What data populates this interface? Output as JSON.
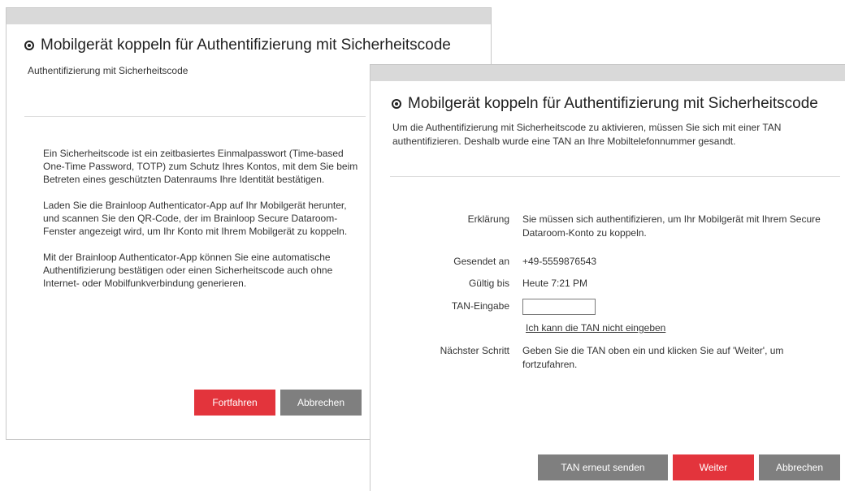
{
  "dialog_back": {
    "title": "Mobilgerät koppeln für Authentifizierung mit Sicherheitscode",
    "subtitle": "Authentifizierung mit Sicherheitscode",
    "paragraphs": [
      "Ein Sicherheitscode ist ein zeitbasiertes Einmalpasswort (Time-based One-Time Password, TOTP) zum Schutz Ihres Kontos, mit dem Sie beim Betreten eines geschützten Datenraums Ihre Identität bestätigen.",
      "Laden Sie die Brainloop Authenticator-App auf Ihr Mobilgerät herunter, und scannen Sie den QR-Code, der im Brainloop Secure Dataroom-Fenster angezeigt wird, um Ihr Konto mit Ihrem Mobilgerät zu koppeln.",
      "Mit der Brainloop Authenticator-App können Sie eine automatische Authentifizierung bestätigen oder einen Sicherheitscode auch ohne Internet- oder Mobilfunkverbindung generieren."
    ],
    "buttons": {
      "continue": "Fortfahren",
      "cancel": "Abbrechen"
    }
  },
  "dialog_front": {
    "title": "Mobilgerät koppeln für Authentifizierung mit Sicherheitscode",
    "intro": "Um die Authentifizierung mit Sicherheitscode zu aktivieren, müssen Sie sich mit einer TAN authentifizieren. Deshalb wurde eine TAN an Ihre Mobiltelefonnummer gesandt.",
    "fields": {
      "explanation_label": "Erklärung",
      "explanation_value": "Sie müssen sich authentifizieren, um Ihr Mobilgerät mit Ihrem Secure Dataroom-Konto zu koppeln.",
      "sent_to_label": "Gesendet an",
      "sent_to_value": "+49-5559876543",
      "valid_until_label": "Gültig bis",
      "valid_until_value": "Heute 7:21 PM",
      "tan_label": "TAN-Eingabe",
      "tan_value": "",
      "cannot_enter_link": "Ich kann die TAN nicht eingeben",
      "next_step_label": "Nächster Schritt",
      "next_step_value": "Geben Sie die TAN oben ein und klicken Sie auf 'Weiter', um fortzufahren."
    },
    "buttons": {
      "resend": "TAN erneut senden",
      "next": "Weiter",
      "cancel": "Abbrechen"
    }
  },
  "colors": {
    "accent_red": "#e3343c",
    "button_grey": "#7f7f7f",
    "header_bar": "#d9d9d9"
  },
  "icons": {
    "title_icon": "radio-target-icon"
  }
}
